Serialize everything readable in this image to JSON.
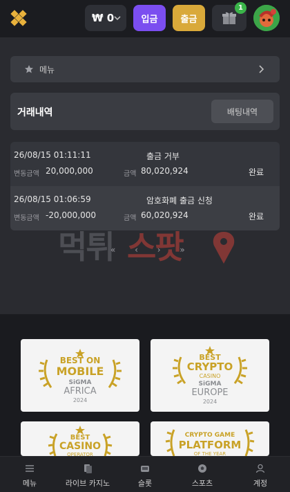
{
  "header": {
    "balance": "₩ 0",
    "deposit_label": "입금",
    "withdraw_label": "출금",
    "gift_count": "1"
  },
  "menu": {
    "label": "메뉴"
  },
  "transactions": {
    "title": "거래내역",
    "bet_history_label": "배팅내역",
    "change_label": "변동금액",
    "amount_label": "금액",
    "rows": [
      {
        "date": "26/08/15 01:11:11",
        "title": "출금 거부",
        "change": "20,000,000",
        "amount": "80,020,924",
        "status": "완료"
      },
      {
        "date": "26/08/15 01:06:59",
        "title": "암호화폐 출금 신청",
        "change": "-20,000,000",
        "amount": "60,020,924",
        "status": "완료"
      }
    ]
  },
  "watermark": {
    "text": "먹튀스팟"
  },
  "pager": {
    "glyphs": "« ‹ › »"
  },
  "awards": [
    {
      "top": "BEST ON",
      "main": "MOBILE",
      "sub": "SiGMA",
      "region": "AFRICA",
      "year": "2024"
    },
    {
      "top": "BEST",
      "main": "CRYPTO",
      "sub2": "CASINO",
      "sub": "SiGMA",
      "region": "EUROPE",
      "year": "2024"
    },
    {
      "top": "BEST",
      "main": "CASINO",
      "sub2": "OPERATOR"
    },
    {
      "top": "CRYPTO GAME",
      "main": "PLATFORM",
      "sub2": "OF THE YEAR"
    }
  ],
  "bottom_nav": [
    {
      "label": "메뉴",
      "icon": "menu-icon"
    },
    {
      "label": "라이브 카지노",
      "icon": "cards-icon"
    },
    {
      "label": "슬롯",
      "icon": "slot-icon"
    },
    {
      "label": "스포츠",
      "icon": "ball-icon"
    },
    {
      "label": "계정",
      "icon": "user-icon"
    }
  ],
  "colors": {
    "deposit": "#7b4ef0",
    "withdraw": "#d9a93a",
    "badge": "#3bb54a",
    "gold": "#c9a227"
  }
}
